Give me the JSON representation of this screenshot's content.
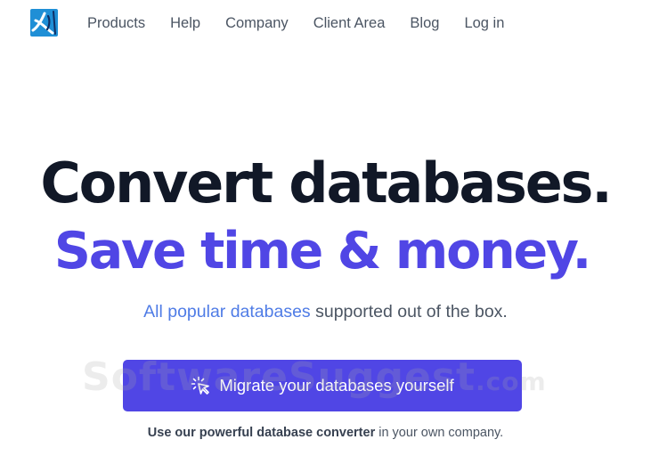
{
  "nav": {
    "logo_icon": "brand-logo-icon",
    "links": [
      "Products",
      "Help",
      "Company",
      "Client Area",
      "Blog",
      "Log in"
    ]
  },
  "hero": {
    "headline": "Convert databases.",
    "subheadline": "Save time & money.",
    "tagline": {
      "link_text": "All popular databases",
      "rest": " supported out of the box."
    },
    "cta": {
      "icon": "cursor-click-icon",
      "label": "Migrate your databases yourself"
    },
    "note": {
      "bold": "Use our powerful database converter",
      "rest": " in your own company."
    }
  },
  "watermark": {
    "text": "SoftwareSuggest",
    "suffix": ".com"
  },
  "colors": {
    "accent": "#5046e5",
    "headline": "#111827",
    "link": "#4f7ce6",
    "nav_text": "#4b5563",
    "logo": "#1f8fd6"
  }
}
